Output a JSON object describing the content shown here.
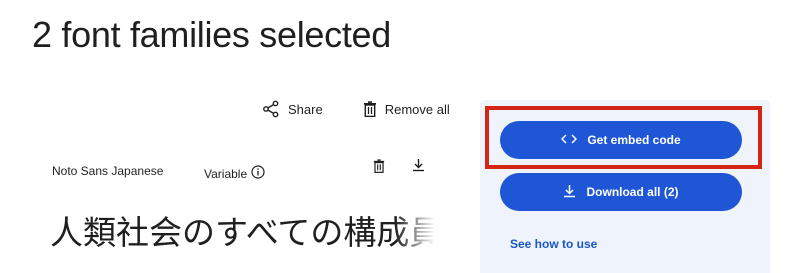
{
  "heading": "2 font families selected",
  "toolbar": {
    "share_label": "Share",
    "remove_all_label": "Remove all"
  },
  "font_row": {
    "name": "Noto Sans Japanese",
    "variable_label": "Variable",
    "info_icon": "info-icon",
    "delete_icon": "trash-icon",
    "download_icon": "download-icon"
  },
  "preview_text": "人類社会のすべての構成員",
  "side_panel": {
    "embed_button_label": "Get embed code",
    "embed_icon": "code-icon",
    "download_button_label": "Download all (2)",
    "download_icon": "download-icon",
    "see_how_label": "See how to use"
  },
  "colors": {
    "primary_button": "#1e56d6",
    "panel_background": "#eff3fb",
    "highlight_border": "#d42414",
    "link": "#1a56c4"
  }
}
